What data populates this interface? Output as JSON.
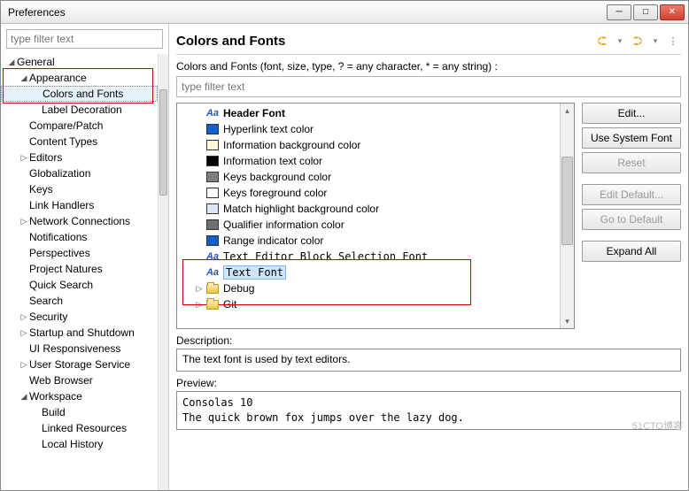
{
  "window": {
    "title": "Preferences"
  },
  "filter": {
    "placeholder": "type filter text"
  },
  "tree": [
    {
      "label": "General",
      "lvl": 0,
      "arr": "open"
    },
    {
      "label": "Appearance",
      "lvl": 1,
      "arr": "open"
    },
    {
      "label": "Colors and Fonts",
      "lvl": 2,
      "arr": "none",
      "sel": true
    },
    {
      "label": "Label Decoration",
      "lvl": 2,
      "arr": "none"
    },
    {
      "label": "Compare/Patch",
      "lvl": 1,
      "arr": "none"
    },
    {
      "label": "Content Types",
      "lvl": 1,
      "arr": "none"
    },
    {
      "label": "Editors",
      "lvl": 1,
      "arr": "closed"
    },
    {
      "label": "Globalization",
      "lvl": 1,
      "arr": "none"
    },
    {
      "label": "Keys",
      "lvl": 1,
      "arr": "none"
    },
    {
      "label": "Link Handlers",
      "lvl": 1,
      "arr": "none"
    },
    {
      "label": "Network Connections",
      "lvl": 1,
      "arr": "closed"
    },
    {
      "label": "Notifications",
      "lvl": 1,
      "arr": "none"
    },
    {
      "label": "Perspectives",
      "lvl": 1,
      "arr": "none"
    },
    {
      "label": "Project Natures",
      "lvl": 1,
      "arr": "none"
    },
    {
      "label": "Quick Search",
      "lvl": 1,
      "arr": "none"
    },
    {
      "label": "Search",
      "lvl": 1,
      "arr": "none"
    },
    {
      "label": "Security",
      "lvl": 1,
      "arr": "closed"
    },
    {
      "label": "Startup and Shutdown",
      "lvl": 1,
      "arr": "closed"
    },
    {
      "label": "UI Responsiveness",
      "lvl": 1,
      "arr": "none"
    },
    {
      "label": "User Storage Service",
      "lvl": 1,
      "arr": "closed"
    },
    {
      "label": "Web Browser",
      "lvl": 1,
      "arr": "none"
    },
    {
      "label": "Workspace",
      "lvl": 1,
      "arr": "open"
    },
    {
      "label": "Build",
      "lvl": 2,
      "arr": "none"
    },
    {
      "label": "Linked Resources",
      "lvl": 2,
      "arr": "none"
    },
    {
      "label": "Local History",
      "lvl": 2,
      "arr": "none"
    }
  ],
  "page": {
    "title": "Colors and Fonts",
    "subtitle": "Colors and Fonts (font, size, type, ? = any character, * = any string) :",
    "filter_placeholder": "type filter text"
  },
  "items": [
    {
      "kind": "font",
      "label": "Header Font",
      "bold": true
    },
    {
      "kind": "color",
      "label": "Hyperlink text color",
      "swatch": "#1060d0"
    },
    {
      "kind": "color",
      "label": "Information background color",
      "swatch": "#fff8d8"
    },
    {
      "kind": "color",
      "label": "Information text color",
      "swatch": "#000000"
    },
    {
      "kind": "color",
      "label": "Keys background color",
      "swatch": "#7f7f7f"
    },
    {
      "kind": "color",
      "label": "Keys foreground color",
      "swatch": "#ffffff"
    },
    {
      "kind": "color",
      "label": "Match highlight background color",
      "swatch": "#d8e8f8"
    },
    {
      "kind": "color",
      "label": "Qualifier information color",
      "swatch": "#6f6f6f"
    },
    {
      "kind": "color",
      "label": "Range indicator color",
      "swatch": "#1060d0"
    },
    {
      "kind": "font",
      "label": "Text Editor Block Selection Font",
      "mono": true
    },
    {
      "kind": "font",
      "label": "Text Font",
      "mono": true,
      "sel": true
    },
    {
      "kind": "folder",
      "label": "Debug",
      "arr": "closed"
    },
    {
      "kind": "folder",
      "label": "Git",
      "arr": "closed"
    }
  ],
  "buttons": {
    "edit": "Edit...",
    "systemfont": "Use System Font",
    "reset": "Reset",
    "editdefault": "Edit Default...",
    "gotodefault": "Go to Default",
    "expandall": "Expand All"
  },
  "description": {
    "label": "Description:",
    "text": "The text font is used by text editors."
  },
  "preview": {
    "label": "Preview:",
    "text": "Consolas 10\nThe quick brown fox jumps over the lazy dog."
  },
  "watermark": "51CTO博客"
}
